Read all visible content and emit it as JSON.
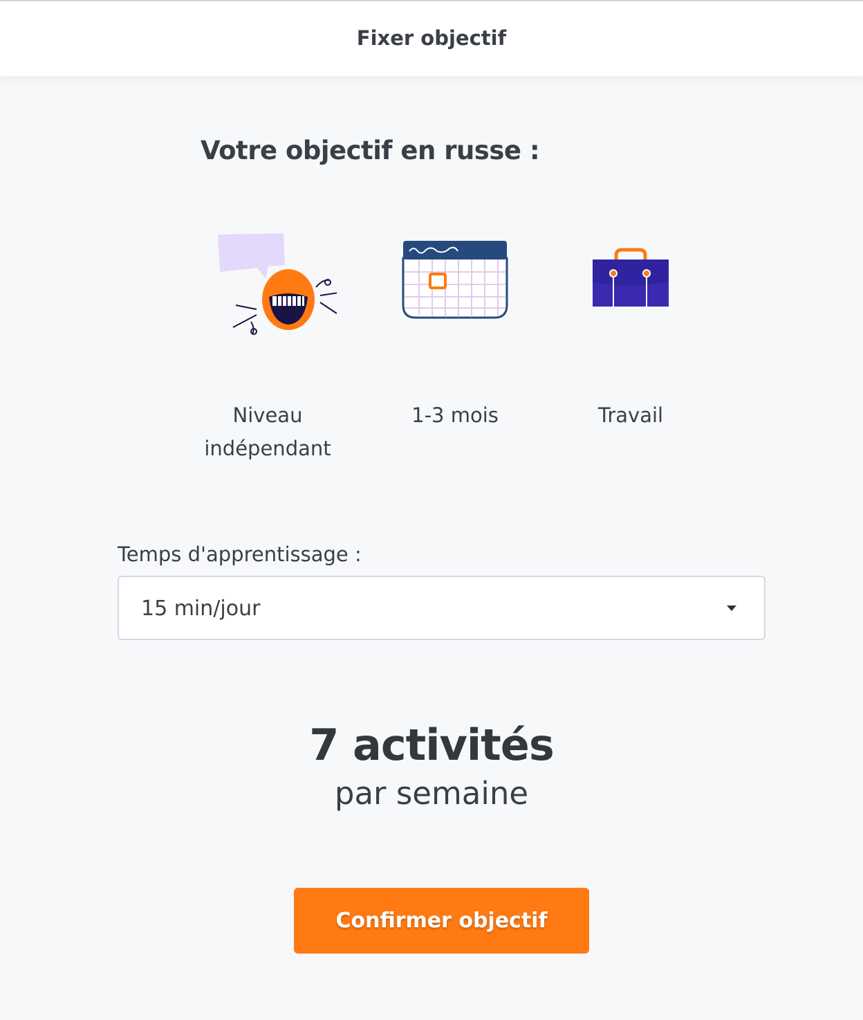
{
  "header": {
    "title": "Fixer objectif"
  },
  "goal": {
    "title": "Votre objectif en russe :",
    "items": [
      {
        "icon": "speaking-mouth-icon",
        "label_line1": "Niveau",
        "label_line2": "indépendant"
      },
      {
        "icon": "calendar-icon",
        "label_line1": "1-3 mois",
        "label_line2": ""
      },
      {
        "icon": "briefcase-icon",
        "label_line1": "Travail",
        "label_line2": ""
      }
    ]
  },
  "study_time": {
    "label": "Temps d'apprentissage :",
    "selected": "15 min/jour"
  },
  "summary": {
    "count": "7 activités",
    "period": "par semaine"
  },
  "actions": {
    "confirm_label": "Confirmer objectif"
  },
  "colors": {
    "accent": "#ff7a12",
    "background": "#f7f8fa",
    "text": "#3a3f47",
    "calendar_header": "#264a7e",
    "briefcase": "#3b2ab0",
    "speech_bubble": "#e3d9fb"
  }
}
